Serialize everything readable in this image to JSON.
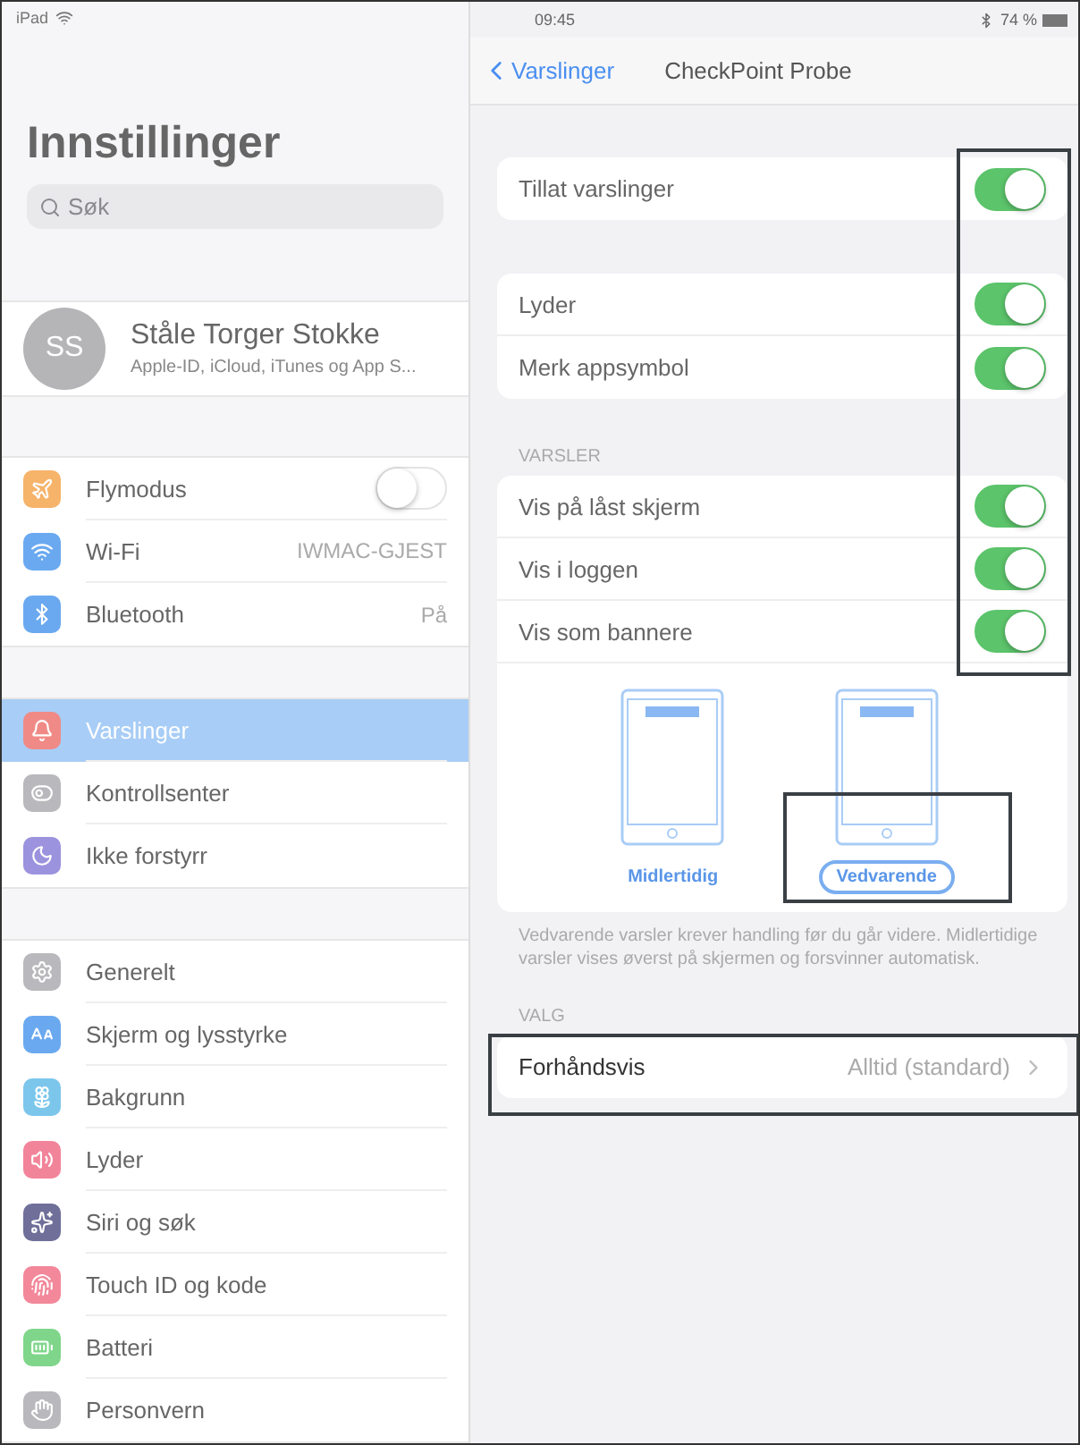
{
  "sidebar": {
    "status": {
      "device": "iPad"
    },
    "title": "Innstillinger",
    "search": {
      "placeholder": "Søk"
    },
    "profile": {
      "initials": "SS",
      "name": "Ståle Torger Stokke",
      "subtitle": "Apple-ID, iCloud, iTunes og App S..."
    },
    "groups": [
      [
        {
          "label": "Flymodus",
          "kind": "toggle",
          "on": false,
          "selected": false,
          "color": "#f6b36a"
        },
        {
          "label": "Wi-Fi",
          "kind": "value",
          "value": "IWMAC-GJEST",
          "selected": false,
          "color": "#6aa9f0"
        },
        {
          "label": "Bluetooth",
          "kind": "value",
          "value": "På",
          "selected": false,
          "color": "#6aa9f0"
        }
      ],
      [
        {
          "label": "Varslinger",
          "kind": "link",
          "selected": true,
          "color": "#f08a86"
        },
        {
          "label": "Kontrollsenter",
          "kind": "link",
          "selected": false,
          "color": "#b9b9bd"
        },
        {
          "label": "Ikke forstyrr",
          "kind": "link",
          "selected": false,
          "color": "#9c93de"
        }
      ],
      [
        {
          "label": "Generelt",
          "kind": "link",
          "selected": false,
          "color": "#b9b9bd"
        },
        {
          "label": "Skjerm og lysstyrke",
          "kind": "link",
          "selected": false,
          "color": "#6aa9f0"
        },
        {
          "label": "Bakgrunn",
          "kind": "link",
          "selected": false,
          "color": "#7cc6ec"
        },
        {
          "label": "Lyder",
          "kind": "link",
          "selected": false,
          "color": "#f2849a"
        },
        {
          "label": "Siri og søk",
          "kind": "link",
          "selected": false,
          "color": "#6f6f9a"
        },
        {
          "label": "Touch ID og kode",
          "kind": "link",
          "selected": false,
          "color": "#f2889a"
        },
        {
          "label": "Batteri",
          "kind": "link",
          "selected": false,
          "color": "#7fd68a"
        },
        {
          "label": "Personvern",
          "kind": "link",
          "selected": false,
          "color": "#b9b9bd"
        }
      ]
    ]
  },
  "detail": {
    "status": {
      "time": "09:45",
      "battery": "74 %"
    },
    "back": "Varslinger",
    "title": "CheckPoint Probe",
    "groups": [
      {
        "rows": [
          {
            "label": "Tillat varslinger",
            "on": true
          }
        ]
      },
      {
        "rows": [
          {
            "label": "Lyder",
            "on": true
          },
          {
            "label": "Merk appsymbol",
            "on": true
          }
        ]
      },
      {
        "header": "VARSLER",
        "rows": [
          {
            "label": "Vis på låst skjerm",
            "on": true
          },
          {
            "label": "Vis i loggen",
            "on": true
          },
          {
            "label": "Vis som bannere",
            "on": true
          }
        ],
        "banner_styles": [
          {
            "label": "Midlertidig",
            "selected": false
          },
          {
            "label": "Vedvarende",
            "selected": true
          }
        ],
        "footer": "Vedvarende varsler krever handling før du går videre. Midlertidige varsler vises øverst på skjermen og forsvinner automatisk."
      }
    ],
    "options": {
      "header": "VALG",
      "label": "Forhåndsvis",
      "value": "Alltid (standard)"
    }
  }
}
